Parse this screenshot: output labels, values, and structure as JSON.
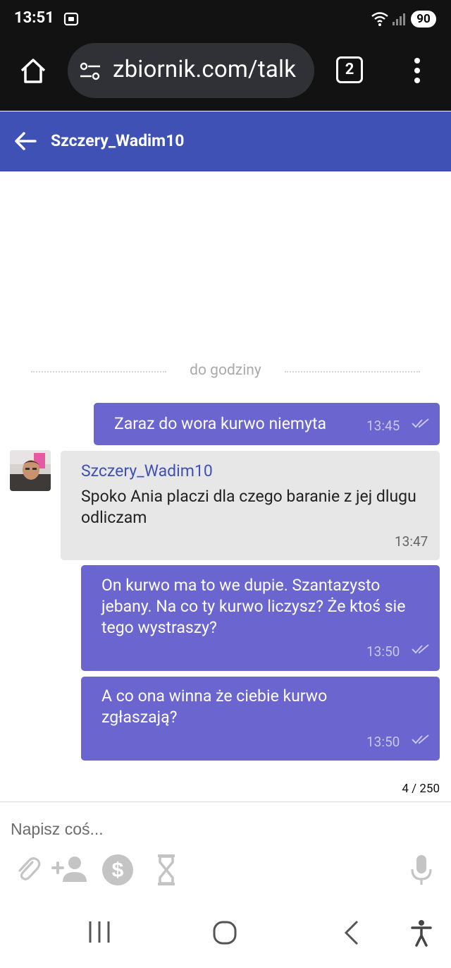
{
  "status": {
    "time": "13:51",
    "battery": "90",
    "icons": [
      "screen-record-icon",
      "wifi-icon",
      "signal-icon"
    ]
  },
  "browser": {
    "url": "zbiornik.com/talk",
    "tab_count": "2",
    "icons": [
      "home-icon",
      "site-settings-icon",
      "more-vert-icon"
    ]
  },
  "header": {
    "title": "Szczery_Wadim10",
    "back_icon": "arrow-back-icon",
    "color": "#3f51b5"
  },
  "chat": {
    "date_separator": "do godziny",
    "messages": [
      {
        "direction": "out",
        "text": "Zaraz do wora kurwo niemyta",
        "time": "13:45",
        "status_icon": "double-check-icon"
      },
      {
        "direction": "in",
        "sender": "Szczery_Wadim10",
        "text": "Spoko Ania placzi dla czego baranie z jej dlugu odliczam",
        "time": "13:47"
      },
      {
        "direction": "out",
        "text": "On kurwo ma to we dupie. Szantazysto jebany. Na co ty kurwo liczysz? Że ktoś sie tego wystraszy?",
        "time": "13:50",
        "status_icon": "double-check-icon"
      },
      {
        "direction": "out",
        "text": "A co ona winna że ciebie kurwo zgłaszają?",
        "time": "13:50",
        "status_icon": "double-check-icon"
      }
    ],
    "outgoing_color": "#6a65cf",
    "incoming_color": "#e7e7e7"
  },
  "composer": {
    "counter": "4 / 250",
    "placeholder": "Napisz coś...",
    "tools": [
      "attach-icon",
      "add-person-icon",
      "dollar-icon",
      "hourglass-icon",
      "mic-icon"
    ]
  },
  "navbar": {
    "buttons": [
      "recent-apps-icon",
      "home-nav-icon",
      "back-nav-icon",
      "accessibility-icon"
    ]
  }
}
